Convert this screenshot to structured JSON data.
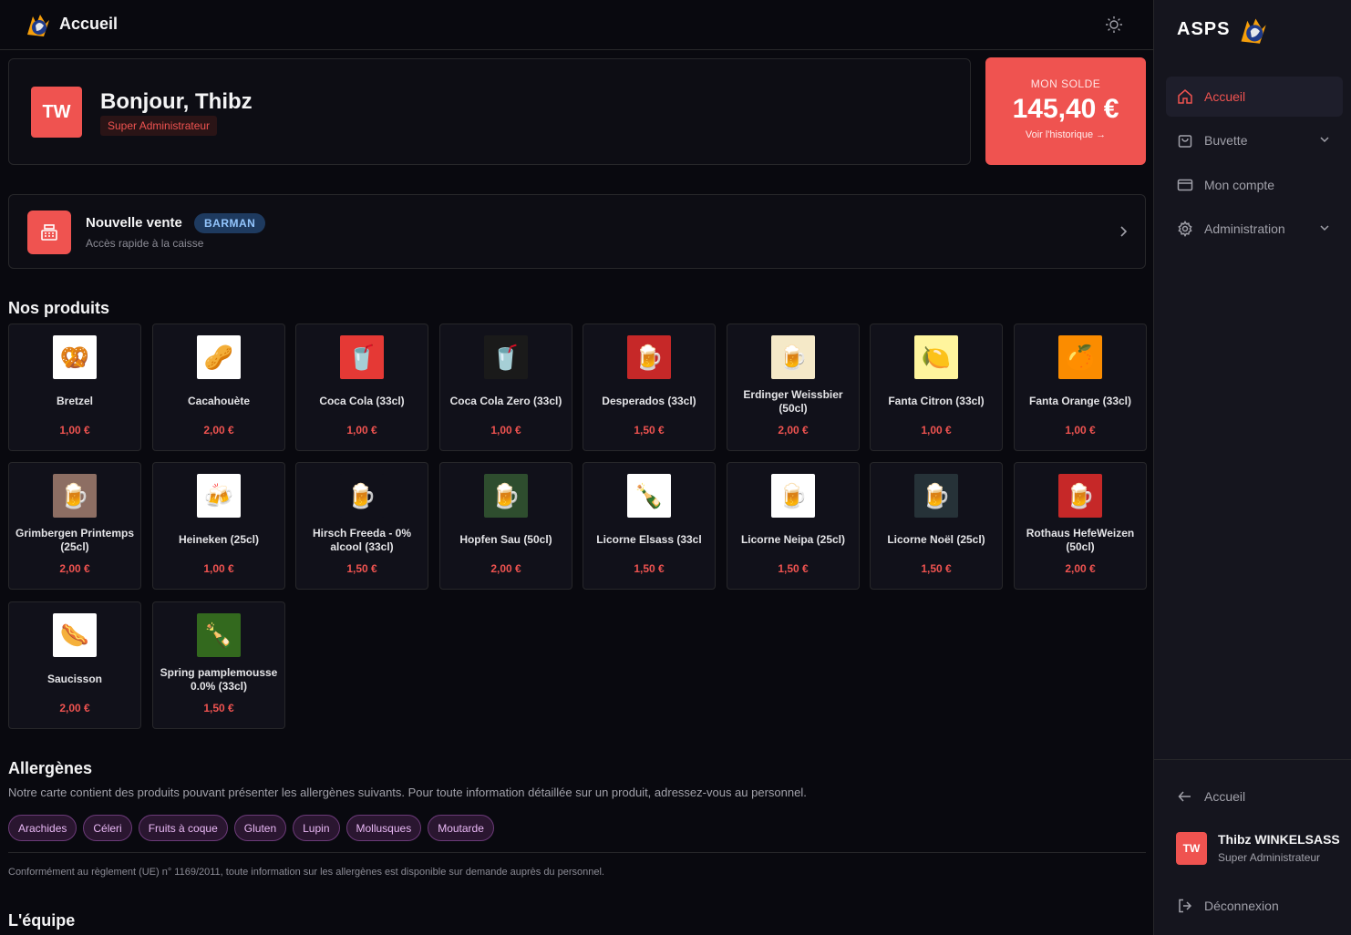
{
  "header": {
    "title": "Accueil"
  },
  "welcome": {
    "initials": "TW",
    "greeting": "Bonjour, Thibz",
    "role": "Super Administrateur"
  },
  "balance": {
    "label": "MON SOLDE",
    "value": "145,40 €",
    "link": "Voir l'historique →"
  },
  "sale": {
    "title": "Nouvelle vente",
    "badge": "BARMAN",
    "subtitle": "Accès rapide à la caisse"
  },
  "products_title": "Nos produits",
  "products": [
    {
      "name": "Bretzel",
      "price": "1,00 €",
      "emoji": "🥨",
      "bg": "#ffffff"
    },
    {
      "name": "Cacahouète",
      "price": "2,00 €",
      "emoji": "🥜",
      "bg": "#ffffff"
    },
    {
      "name": "Coca Cola (33cl)",
      "price": "1,00 €",
      "emoji": "🥤",
      "bg": "#e53935"
    },
    {
      "name": "Coca Cola Zero (33cl)",
      "price": "1,00 €",
      "emoji": "🥤",
      "bg": "#1a1a1a"
    },
    {
      "name": "Desperados (33cl)",
      "price": "1,50 €",
      "emoji": "🍺",
      "bg": "#c62828"
    },
    {
      "name": "Erdinger Weissbier (50cl)",
      "price": "2,00 €",
      "emoji": "🍺",
      "bg": "#f5e9c8"
    },
    {
      "name": "Fanta Citron (33cl)",
      "price": "1,00 €",
      "emoji": "🍋",
      "bg": "#fff59d"
    },
    {
      "name": "Fanta Orange (33cl)",
      "price": "1,00 €",
      "emoji": "🍊",
      "bg": "#fb8c00"
    },
    {
      "name": "Grimbergen Printemps (25cl)",
      "price": "2,00 €",
      "emoji": "🍺",
      "bg": "#8d6e63"
    },
    {
      "name": "Heineken (25cl)",
      "price": "1,00 €",
      "emoji": "🍻",
      "bg": "#ffffff"
    },
    {
      "name": "Hirsch Freeda - 0% alcool (33cl)",
      "price": "1,50 €",
      "emoji": "🍺",
      "bg": "#11111a"
    },
    {
      "name": "Hopfen Sau (50cl)",
      "price": "2,00 €",
      "emoji": "🍺",
      "bg": "#2e4d2e"
    },
    {
      "name": "Licorne Elsass (33cl",
      "price": "1,50 €",
      "emoji": "🍾",
      "bg": "#ffffff"
    },
    {
      "name": "Licorne Neipa (25cl)",
      "price": "1,50 €",
      "emoji": "🍺",
      "bg": "#ffffff"
    },
    {
      "name": "Licorne Noël (25cl)",
      "price": "1,50 €",
      "emoji": "🍺",
      "bg": "#263238"
    },
    {
      "name": "Rothaus HefeWeizen (50cl)",
      "price": "2,00 €",
      "emoji": "🍺",
      "bg": "#c62828"
    },
    {
      "name": "Saucisson",
      "price": "2,00 €",
      "emoji": "🌭",
      "bg": "#ffffff"
    },
    {
      "name": "Spring pamplemousse 0.0% (33cl)",
      "price": "1,50 €",
      "emoji": "🍾",
      "bg": "#33691e"
    }
  ],
  "allergens": {
    "title": "Allergènes",
    "text": "Notre carte contient des produits pouvant présenter les allergènes suivants. Pour toute information détaillée sur un produit, adressez-vous au personnel.",
    "items": [
      "Arachides",
      "Céleri",
      "Fruits à coque",
      "Gluten",
      "Lupin",
      "Mollusques",
      "Moutarde"
    ],
    "legal": "Conformément au règlement (UE) n° 1169/2011, toute information sur les allergènes est disponible sur demande auprès du personnel."
  },
  "team_title": "L'équipe",
  "sidebar": {
    "brand": "ASPS",
    "items": [
      {
        "label": "Accueil",
        "icon": "home-icon"
      },
      {
        "label": "Buvette",
        "icon": "bag-icon"
      },
      {
        "label": "Mon compte",
        "icon": "card-icon"
      },
      {
        "label": "Administration",
        "icon": "gear-icon"
      }
    ],
    "back_label": "Accueil",
    "user": {
      "initials": "TW",
      "name": "Thibz WINKELSASS",
      "role": "Super Administrateur"
    },
    "logout_label": "Déconnexion"
  },
  "colors": {
    "accent": "#ef5350",
    "background": "#09090f",
    "sidebar": "#15151e"
  }
}
